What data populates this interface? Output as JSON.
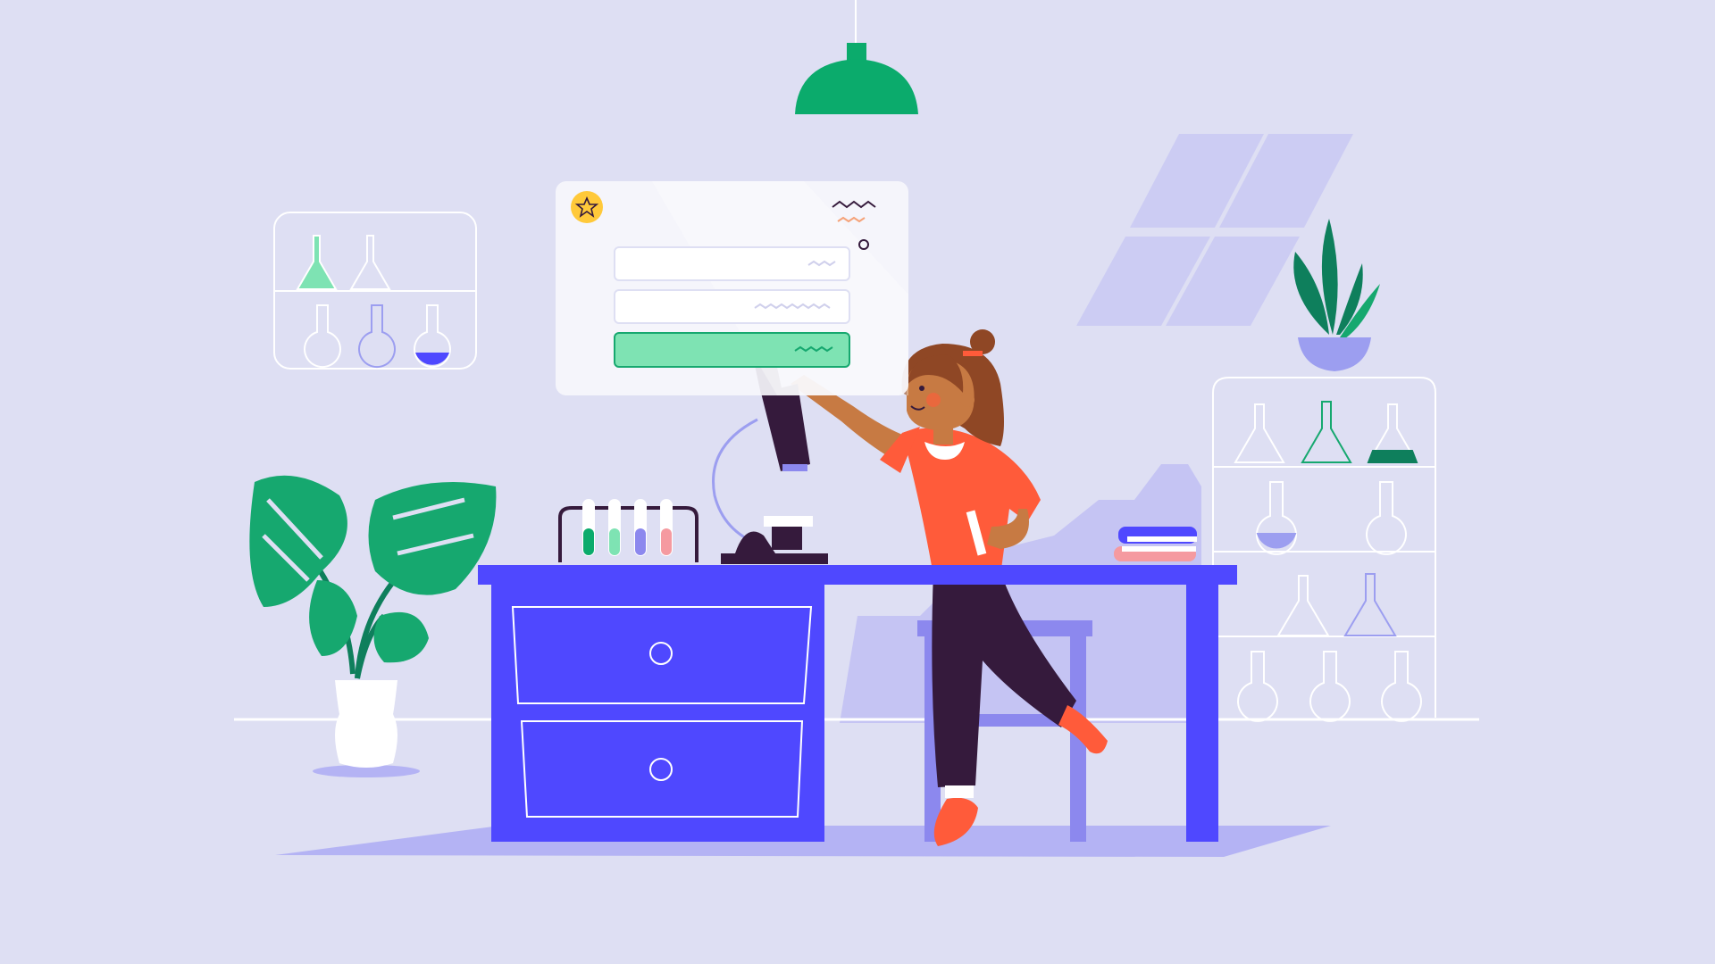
{
  "scene": {
    "palette": {
      "background": "#dedff3",
      "desk": "#4f48ff",
      "floor_shadow": "#b4b3f4",
      "green": "#16a86f",
      "light_green": "#7ee3b3",
      "shirt": "#ff5b3a",
      "pants": "#351a3c",
      "hair": "#8f4725",
      "skin": "#c77a43",
      "lamp": "#0bab6c",
      "star_badge": "#ffc93a"
    }
  },
  "form_card": {
    "badge_icon": "star-icon",
    "fields": [
      {
        "kind": "text-field",
        "value": ""
      },
      {
        "kind": "text-field",
        "value": ""
      },
      {
        "kind": "submit-button",
        "value": ""
      }
    ]
  }
}
